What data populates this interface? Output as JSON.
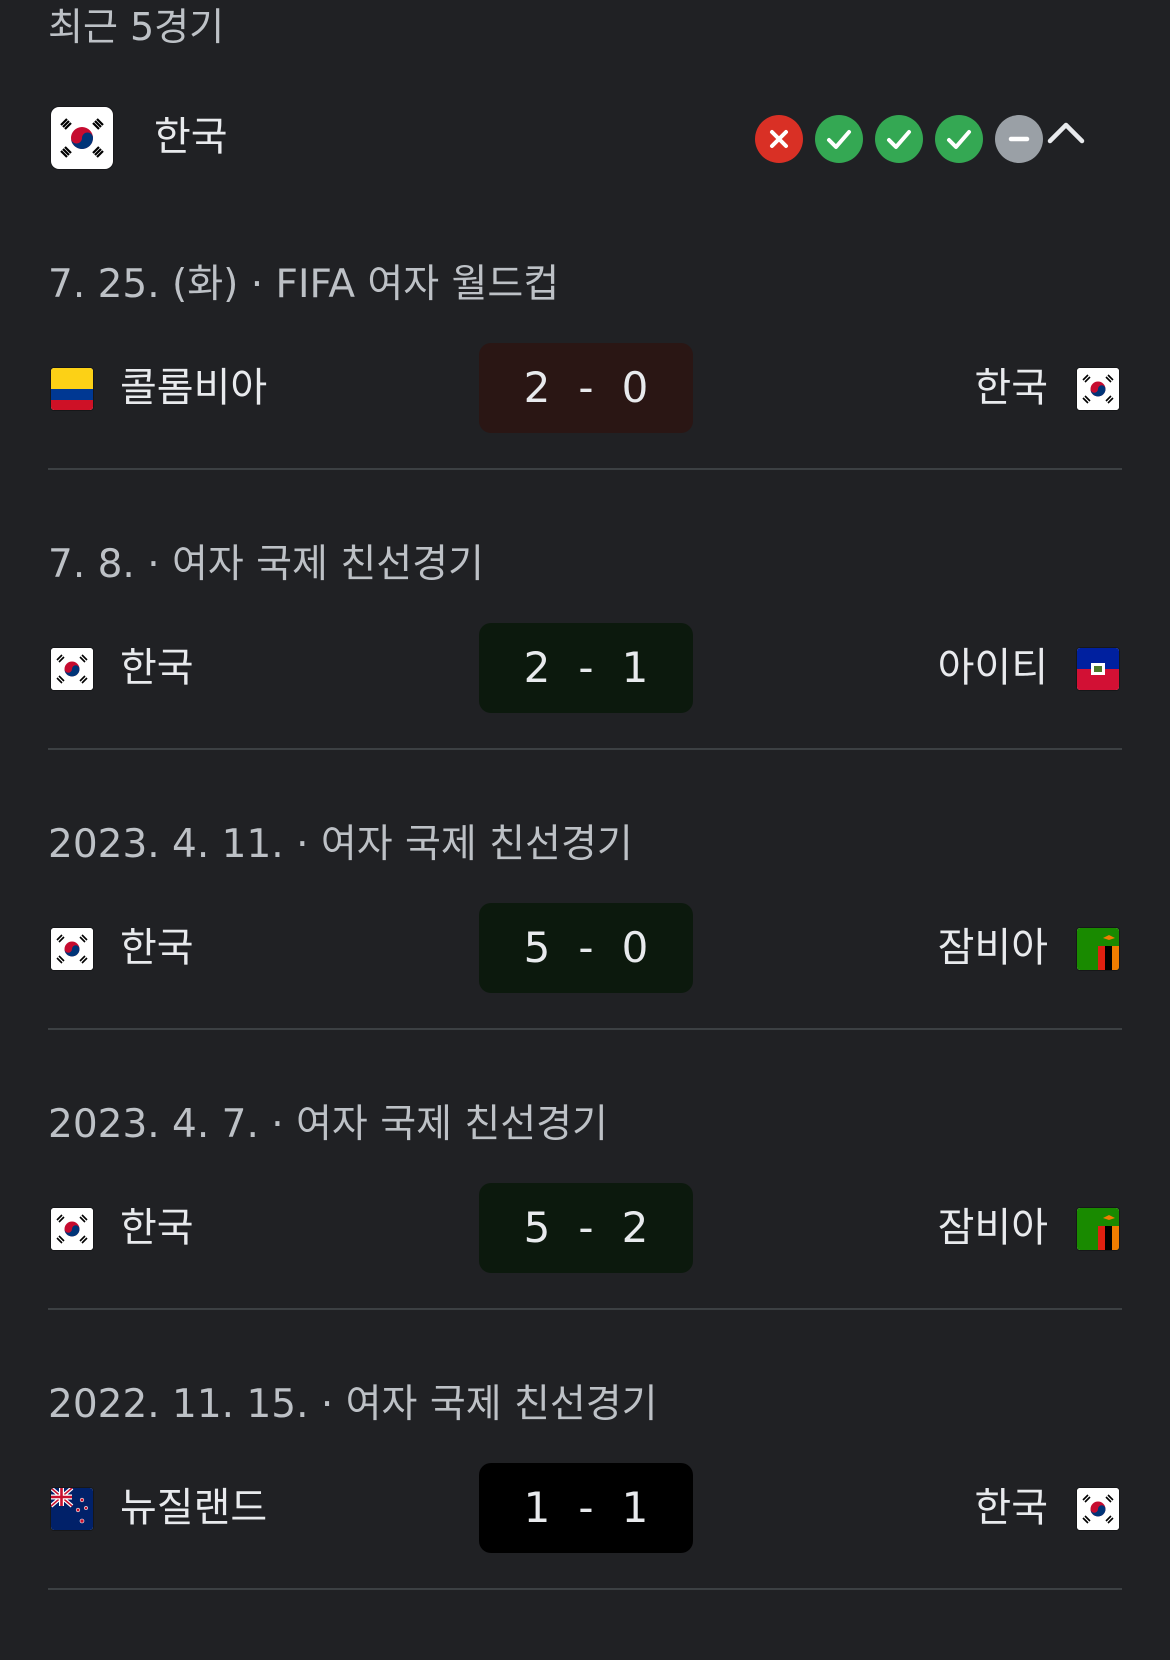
{
  "section_title": "최근 5경기",
  "team": {
    "name": "한국",
    "flag_icon": "south-korea-flag-icon"
  },
  "form": [
    {
      "result": "loss",
      "icon": "x-icon",
      "color": "#d93025"
    },
    {
      "result": "win",
      "icon": "check-icon",
      "color": "#34a853"
    },
    {
      "result": "win",
      "icon": "check-icon",
      "color": "#34a853"
    },
    {
      "result": "win",
      "icon": "check-icon",
      "color": "#34a853"
    },
    {
      "result": "draw",
      "icon": "minus-icon",
      "color": "#9aa0a6"
    }
  ],
  "expand_icon": "chevron-up-icon",
  "matches": [
    {
      "meta": "7. 25. (화) · FIFA 여자 월드컵",
      "home": {
        "name": "콜롬비아",
        "flag": "colombia-flag-icon"
      },
      "away": {
        "name": "한국",
        "flag": "south-korea-flag-icon"
      },
      "score_home": "2",
      "score_sep": "-",
      "score_away": "0",
      "outcome": "loss"
    },
    {
      "meta": "7. 8. · 여자 국제 친선경기",
      "home": {
        "name": "한국",
        "flag": "south-korea-flag-icon"
      },
      "away": {
        "name": "아이티",
        "flag": "haiti-flag-icon"
      },
      "score_home": "2",
      "score_sep": "-",
      "score_away": "1",
      "outcome": "win"
    },
    {
      "meta": "2023. 4. 11. · 여자 국제 친선경기",
      "home": {
        "name": "한국",
        "flag": "south-korea-flag-icon"
      },
      "away": {
        "name": "잠비아",
        "flag": "zambia-flag-icon"
      },
      "score_home": "5",
      "score_sep": "-",
      "score_away": "0",
      "outcome": "win"
    },
    {
      "meta": "2023. 4. 7. · 여자 국제 친선경기",
      "home": {
        "name": "한국",
        "flag": "south-korea-flag-icon"
      },
      "away": {
        "name": "잠비아",
        "flag": "zambia-flag-icon"
      },
      "score_home": "5",
      "score_sep": "-",
      "score_away": "2",
      "outcome": "win"
    },
    {
      "meta": "2022. 11. 15. · 여자 국제 친선경기",
      "home": {
        "name": "뉴질랜드",
        "flag": "new-zealand-flag-icon"
      },
      "away": {
        "name": "한국",
        "flag": "south-korea-flag-icon"
      },
      "score_home": "1",
      "score_sep": "-",
      "score_away": "1",
      "outcome": "draw"
    }
  ]
}
